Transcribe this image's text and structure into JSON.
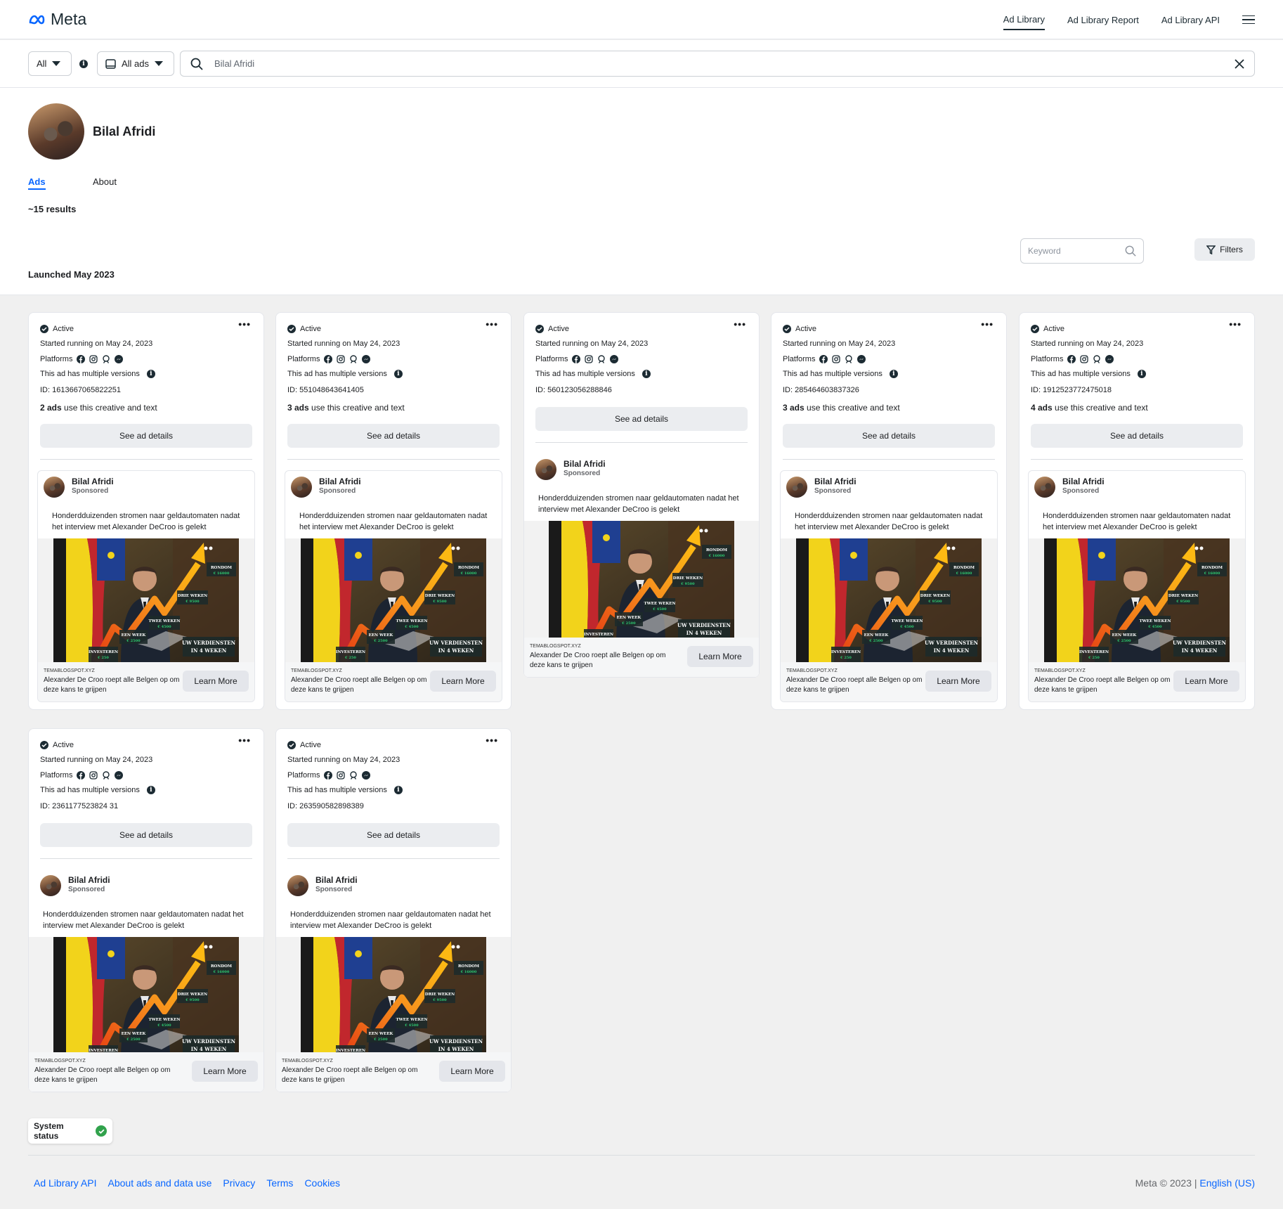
{
  "header": {
    "logo": "Meta",
    "tabs": [
      "Ad Library",
      "Ad Library Report",
      "Ad Library API"
    ]
  },
  "search": {
    "country": "All",
    "ad_type": "All ads",
    "query": "Bilal Afridi"
  },
  "profile": {
    "name": "Bilal Afridi",
    "tabs": [
      "Ads",
      "About"
    ],
    "results": "~15 results"
  },
  "toolbar": {
    "keyword_placeholder": "Keyword",
    "filters_label": "Filters"
  },
  "section": {
    "launched": "Launched May 2023"
  },
  "cards": [
    {
      "status": "Active",
      "started": "Started running on May 24, 2023",
      "platforms": "Platforms",
      "versions": "This ad has multiple versions",
      "id": "ID: 1613667065822251",
      "count": "2 ads",
      "count_suffix": " use this creative and text",
      "see": "See ad details",
      "advertiser": "Bilal Afridi",
      "sponsored": "Sponsored",
      "body": "Honderdduizenden stromen naar geldautomaten nadat het interview met Alexander DeCroo is gelekt",
      "domain": "TEMABLOGSPOT.XYZ",
      "caption": "Alexander De Croo roept alle Belgen op om deze kans te grijpen",
      "cta": "Learn More"
    },
    {
      "status": "Active",
      "started": "Started running on May 24, 2023",
      "platforms": "Platforms",
      "versions": "This ad has multiple versions",
      "id": "ID: 551048643641405",
      "count": "3 ads",
      "count_suffix": " use this creative and text",
      "see": "See ad details",
      "advertiser": "Bilal Afridi",
      "sponsored": "Sponsored",
      "body": "Honderdduizenden stromen naar geldautomaten nadat het interview met Alexander DeCroo is gelekt",
      "domain": "TEMABLOGSPOT.XYZ",
      "caption": "Alexander De Croo roept alle Belgen op om deze kans te grijpen",
      "cta": "Learn More"
    },
    {
      "status": "Active",
      "started": "Started running on May 24, 2023",
      "platforms": "Platforms",
      "versions": "This ad has multiple versions",
      "id": "ID: 560123056288846",
      "count": "",
      "count_suffix": "",
      "see": "See ad details",
      "advertiser": "Bilal Afridi",
      "sponsored": "Sponsored",
      "body": "Honderdduizenden stromen naar geldautomaten nadat het interview met Alexander DeCroo is gelekt",
      "domain": "TEMABLOGSPOT.XYZ",
      "caption": "Alexander De Croo roept alle Belgen op om deze kans te grijpen",
      "cta": "Learn More"
    },
    {
      "status": "Active",
      "started": "Started running on May 24, 2023",
      "platforms": "Platforms",
      "versions": "This ad has multiple versions",
      "id": "ID: 285464603837326",
      "count": "3 ads",
      "count_suffix": " use this creative and text",
      "see": "See ad details",
      "advertiser": "Bilal Afridi",
      "sponsored": "Sponsored",
      "body": "Honderdduizenden stromen naar geldautomaten nadat het interview met Alexander DeCroo is gelekt",
      "domain": "TEMABLOGSPOT.XYZ",
      "caption": "Alexander De Croo roept alle Belgen op om deze kans te grijpen",
      "cta": "Learn More"
    },
    {
      "status": "Active",
      "started": "Started running on May 24, 2023",
      "platforms": "Platforms",
      "versions": "This ad has multiple versions",
      "id": "ID: 1912523772475018",
      "count": "4 ads",
      "count_suffix": " use this creative and text",
      "see": "See ad details",
      "advertiser": "Bilal Afridi",
      "sponsored": "Sponsored",
      "body": "Honderdduizenden stromen naar geldautomaten nadat het interview met Alexander DeCroo is gelekt",
      "domain": "TEMABLOGSPOT.XYZ",
      "caption": "Alexander De Croo roept alle Belgen op om deze kans te grijpen",
      "cta": "Learn More"
    },
    {
      "status": "Active",
      "started": "Started running on May 24, 2023",
      "platforms": "Platforms",
      "versions": "This ad has multiple versions",
      "id": "ID: 2361177523824 31",
      "count": "",
      "count_suffix": "",
      "see": "See ad details",
      "advertiser": "Bilal Afridi",
      "sponsored": "Sponsored",
      "body": "Honderdduizenden stromen naar geldautomaten nadat het interview met Alexander DeCroo is gelekt",
      "domain": "TEMABLOGSPOT.XYZ",
      "caption": "Alexander De Croo roept alle Belgen op om deze kans te grijpen",
      "cta": "Learn More"
    },
    {
      "status": "Active",
      "started": "Started running on May 24, 2023",
      "platforms": "Platforms",
      "versions": "This ad has multiple versions",
      "id": "ID: 263590582898389",
      "count": "",
      "count_suffix": "",
      "see": "See ad details",
      "advertiser": "Bilal Afridi",
      "sponsored": "Sponsored",
      "body": "Honderdduizenden stromen naar geldautomaten nadat het interview met Alexander DeCroo is gelekt",
      "domain": "TEMABLOGSPOT.XYZ",
      "caption": "Alexander De Croo roept alle Belgen op om deze kans te grijpen",
      "cta": "Learn More"
    }
  ],
  "ad_image_text": {
    "l1": "RONDOM",
    "v1": "€ 16000",
    "l2": "DRIE WEKEN",
    "v2": "€ 9500",
    "l3": "TWEE WEKEN",
    "v3": "€ 4500",
    "l4": "EEN WEEK",
    "v4": "€ 2500",
    "l5": "INVESTEREN",
    "v5": "€ 250",
    "l6a": "UW VERDIENSTEN",
    "l6b": "IN 4 WEKEN"
  },
  "system_status": "System status",
  "footer": {
    "links": [
      "Ad Library API",
      "About ads and data use",
      "Privacy",
      "Terms",
      "Cookies"
    ],
    "copyright": "Meta © 2023 |",
    "language": "English (US)"
  }
}
